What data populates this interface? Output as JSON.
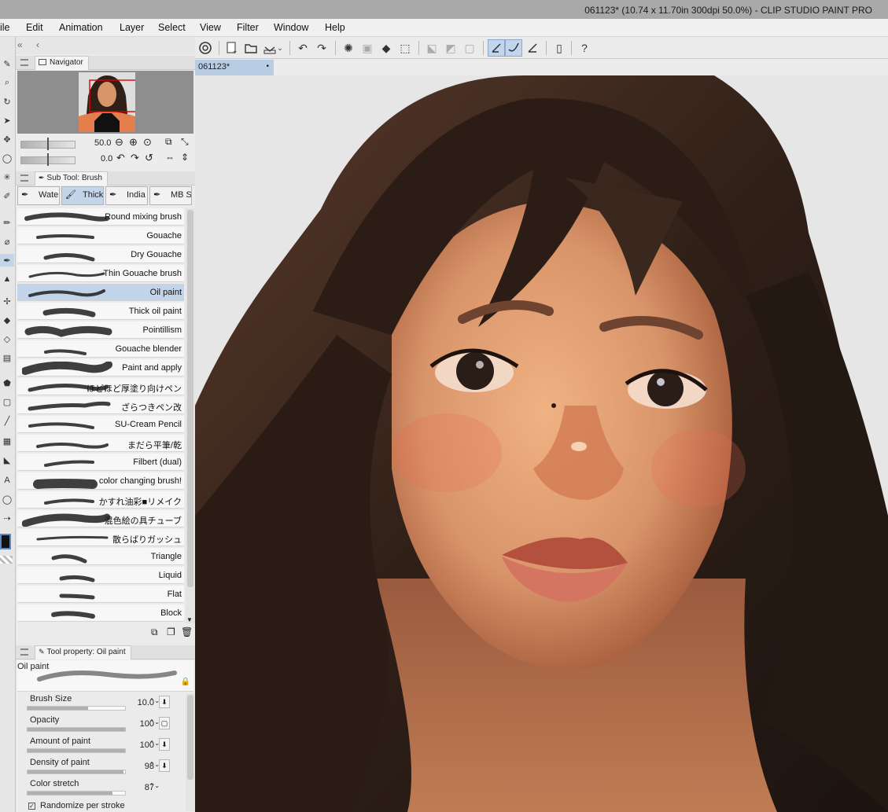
{
  "window": {
    "title": "061123* (10.74 x 11.70in 300dpi 50.0%)  - CLIP STUDIO PAINT PRO"
  },
  "menu": [
    "ile",
    "Edit",
    "Animation",
    "Layer",
    "Select",
    "View",
    "Filter",
    "Window",
    "Help"
  ],
  "canvas_tab": {
    "label": "061123*",
    "modified_dot": "•"
  },
  "navigator": {
    "panel_title": "Navigator",
    "zoom_value": "50.0",
    "rotate_value": "0.0"
  },
  "subtool": {
    "panel_title": "Sub Tool: Brush",
    "tabs": [
      "Wate",
      "Thick",
      "India",
      "MB S"
    ],
    "active_tab": 1,
    "brushes": [
      "Round mixing brush",
      "Gouache",
      "Dry Gouache",
      "Thin Gouache brush",
      "Oil paint",
      "Thick oil paint",
      "Pointillism",
      "Gouache blender",
      "Paint and apply",
      "ほどほど厚塗り向けペン",
      "ざらつきペン改",
      "SU-Cream Pencil",
      "まだら平筆/乾",
      "Filbert (dual)",
      "color changing brush!",
      "かすれ油彩■リメイク",
      "混色絵の具チューブ",
      "散らばりガッシュ",
      "Triangle",
      "Liquid",
      "Flat",
      "Block"
    ],
    "selected": 4
  },
  "tool_property": {
    "panel_title": "Tool property: Oil paint",
    "preset_name": "Oil paint",
    "props": [
      {
        "label": "Brush Size",
        "value": "10.0",
        "fill_fraction": 0.62
      },
      {
        "label": "Opacity",
        "value": "100",
        "fill_fraction": 1.0
      },
      {
        "label": "Amount of paint",
        "value": "100",
        "fill_fraction": 1.0
      },
      {
        "label": "Density of paint",
        "value": "98",
        "fill_fraction": 0.98
      },
      {
        "label": "Color stretch",
        "value": "87",
        "fill_fraction": 0.87
      }
    ],
    "checkbox_label": "Randomize per stroke"
  },
  "colors": {
    "selection": "#c1d4ea",
    "canvas_tab": "#b8cce4",
    "nav_frame": "#e00000",
    "hair": "#2e1f17",
    "skin": "#d9956a"
  }
}
